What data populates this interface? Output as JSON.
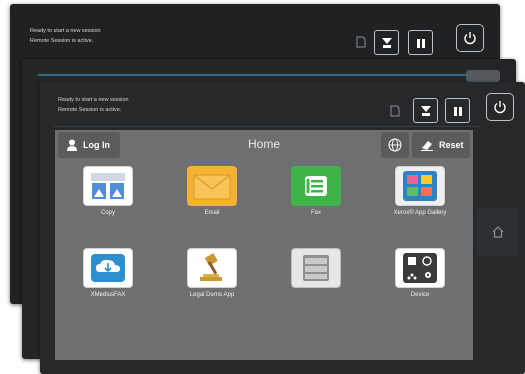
{
  "status": {
    "line1": "Ready to start a new session",
    "line2": "Remote Session is active."
  },
  "topbar": {
    "login_label": "Log In",
    "title": "Home",
    "reset_label": "Reset"
  },
  "apps": [
    {
      "label": "Copy",
      "icon": "copy-icon",
      "color": "#4f8ed6"
    },
    {
      "label": "Email",
      "icon": "email-icon",
      "color": "#f5b335"
    },
    {
      "label": "Fax",
      "icon": "fax-icon",
      "color": "#3fb449"
    },
    {
      "label": "Xerox® App Gallery",
      "icon": "app-gallery-icon",
      "color": "#2e82c6"
    },
    {
      "label": "XMediusFAX",
      "icon": "xmediusfax-icon",
      "color": "#2b8fd0"
    },
    {
      "label": "Legal Demo App",
      "icon": "legal-gavel-icon",
      "color": "#c89a2e"
    },
    {
      "label": "",
      "icon": "file-drawer-icon",
      "color": "#9a9b9d"
    },
    {
      "label": "Device",
      "icon": "device-icon",
      "color": "#3a3b3d"
    }
  ],
  "icons": {
    "power": "power-icon",
    "pause": "pause-icon",
    "job_status": "job-status-icon",
    "home": "home-icon",
    "globe": "globe-icon",
    "eraser": "eraser-icon",
    "user": "user-icon"
  }
}
